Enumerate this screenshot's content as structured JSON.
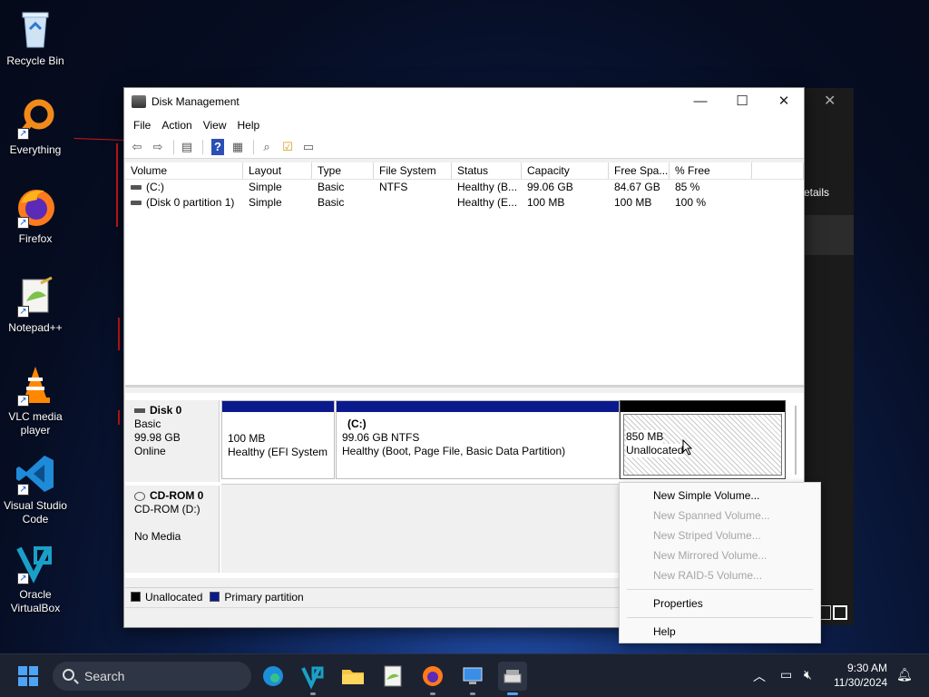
{
  "desktop": {
    "icons": [
      {
        "label": "Recycle Bin"
      },
      {
        "label": "Everything"
      },
      {
        "label": "Firefox"
      },
      {
        "label": "Notepad++"
      },
      {
        "label_line1": "VLC media",
        "label_line2": "player"
      },
      {
        "label_line1": "Visual Studio",
        "label_line2": "Code"
      },
      {
        "label_line1": "Oracle",
        "label_line2": "VirtualBox"
      }
    ]
  },
  "bg_window": {
    "partial_text": "etails",
    "close": "✕"
  },
  "window": {
    "title": "Disk Management",
    "controls": {
      "minimize": "—",
      "maximize": "☐",
      "close": "✕"
    },
    "menu": [
      "File",
      "Action",
      "View",
      "Help"
    ],
    "columns": [
      "Volume",
      "Layout",
      "Type",
      "File System",
      "Status",
      "Capacity",
      "Free Spa...",
      "% Free",
      ""
    ],
    "volumes": [
      {
        "volume": "(C:)",
        "layout": "Simple",
        "type": "Basic",
        "fs": "NTFS",
        "status": "Healthy (B...",
        "capacity": "99.06 GB",
        "free": "84.67 GB",
        "pct": "85 %"
      },
      {
        "volume": "(Disk 0 partition 1)",
        "layout": "Simple",
        "type": "Basic",
        "fs": "",
        "status": "Healthy (E...",
        "capacity": "100 MB",
        "free": "100 MB",
        "pct": "100 %"
      }
    ],
    "disk0": {
      "name": "Disk 0",
      "type": "Basic",
      "size": "99.98 GB",
      "state": "Online",
      "partitions": [
        {
          "size": "100 MB",
          "status": "Healthy (EFI System Partition)"
        },
        {
          "name": "(C:)",
          "size": "99.06 GB NTFS",
          "status": "Healthy (Boot, Page File, Basic Data Partition)"
        },
        {
          "size": "850 MB",
          "status": "Unallocated"
        }
      ]
    },
    "cdrom": {
      "name": "CD-ROM 0",
      "type": "CD-ROM (D:)",
      "media": "No Media"
    },
    "legend": {
      "unallocated": "Unallocated",
      "primary": "Primary partition"
    },
    "colors": {
      "primary": "#0a1a8c",
      "unallocated": "#000000"
    }
  },
  "context_menu": {
    "items": [
      {
        "label": "New Simple Volume...",
        "enabled": true
      },
      {
        "label": "New Spanned Volume...",
        "enabled": false
      },
      {
        "label": "New Striped Volume...",
        "enabled": false
      },
      {
        "label": "New Mirrored Volume...",
        "enabled": false
      },
      {
        "label": "New RAID-5 Volume...",
        "enabled": false
      },
      {
        "label": "Properties",
        "enabled": true
      },
      {
        "label": "Help",
        "enabled": true
      }
    ]
  },
  "taskbar": {
    "search_placeholder": "Search",
    "time": "9:30 AM",
    "date": "11/30/2024"
  }
}
